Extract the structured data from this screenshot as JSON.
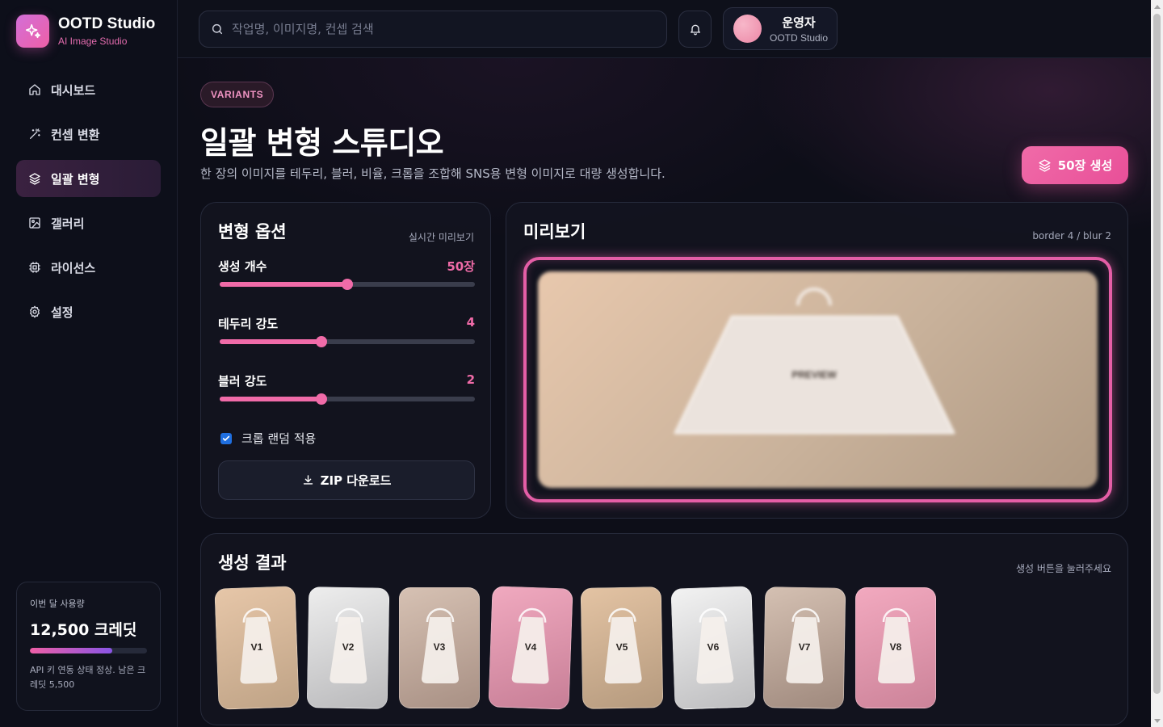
{
  "brand": {
    "title": "OOTD Studio",
    "subtitle": "AI Image Studio"
  },
  "sidebar": {
    "items": [
      {
        "label": "대시보드",
        "icon": "home-icon",
        "active": false
      },
      {
        "label": "컨셉 변환",
        "icon": "wand-icon",
        "active": false
      },
      {
        "label": "일괄 변형",
        "icon": "layers-icon",
        "active": true
      },
      {
        "label": "갤러리",
        "icon": "image-icon",
        "active": false
      },
      {
        "label": "라이선스",
        "icon": "chip-icon",
        "active": false
      },
      {
        "label": "설정",
        "icon": "gear-icon",
        "active": false
      }
    ],
    "usage": {
      "label": "이번 달 사용량",
      "value": "12,500 크레딧",
      "progress_fraction": 0.7,
      "note": "API 키 연동 상태 정상. 남은 크레딧 5,500"
    }
  },
  "header": {
    "search_placeholder": "작업명, 이미지명, 컨셉 검색",
    "user": {
      "name": "운영자",
      "org": "OOTD Studio"
    }
  },
  "main": {
    "tag": "VARIANTS",
    "title": "일괄 변형 스튜디오",
    "description": "한 장의 이미지를 테두리, 블러, 비율, 크롭을 조합해 SNS용 변형 이미지로 대량 생성합니다.",
    "generate_label": "50장 생성",
    "options": {
      "title": "변형 옵션",
      "hint": "실시간 미리보기",
      "count": {
        "label": "생성 개수",
        "value": "50장",
        "fraction": 0.5
      },
      "border": {
        "label": "테두리 강도",
        "value": "4",
        "fraction": 0.4
      },
      "blur": {
        "label": "블러 강도",
        "value": "2",
        "fraction": 0.4
      },
      "crop_random": {
        "label": "크롭 랜덤 적용",
        "checked": true
      },
      "zip_label": "ZIP 다운로드"
    },
    "preview": {
      "title": "미리보기",
      "params": "border 4 / blur 2",
      "image_text": "PREVIEW"
    },
    "results": {
      "title": "생성 결과",
      "hint": "생성 버튼을 눌러주세요",
      "items": [
        {
          "label": "V1",
          "color_top": "#e6c6a8",
          "color_bottom": "#bfa386",
          "rotate": -2
        },
        {
          "label": "V2",
          "color_top": "#ededed",
          "color_bottom": "#b9b9bb",
          "rotate": 1
        },
        {
          "label": "V3",
          "color_top": "#d6c1b3",
          "color_bottom": "#a89084",
          "rotate": 0
        },
        {
          "label": "V4",
          "color_top": "#f0a9bf",
          "color_bottom": "#c77e96",
          "rotate": 2
        },
        {
          "label": "V5",
          "color_top": "#e3c3a3",
          "color_bottom": "#b59a7e",
          "rotate": -1
        },
        {
          "label": "V6",
          "color_top": "#f2f2f2",
          "color_bottom": "#bdbdbf",
          "rotate": -2
        },
        {
          "label": "V7",
          "color_top": "#d4c0b2",
          "color_bottom": "#9f897d",
          "rotate": 1
        },
        {
          "label": "V8",
          "color_top": "#f2a9bf",
          "color_bottom": "#cc8399",
          "rotate": 0
        }
      ]
    }
  },
  "colors": {
    "accent": "#f06ba8",
    "background": "#0c0d16",
    "card": "#121420",
    "checkbox": "#1f6fe0"
  }
}
